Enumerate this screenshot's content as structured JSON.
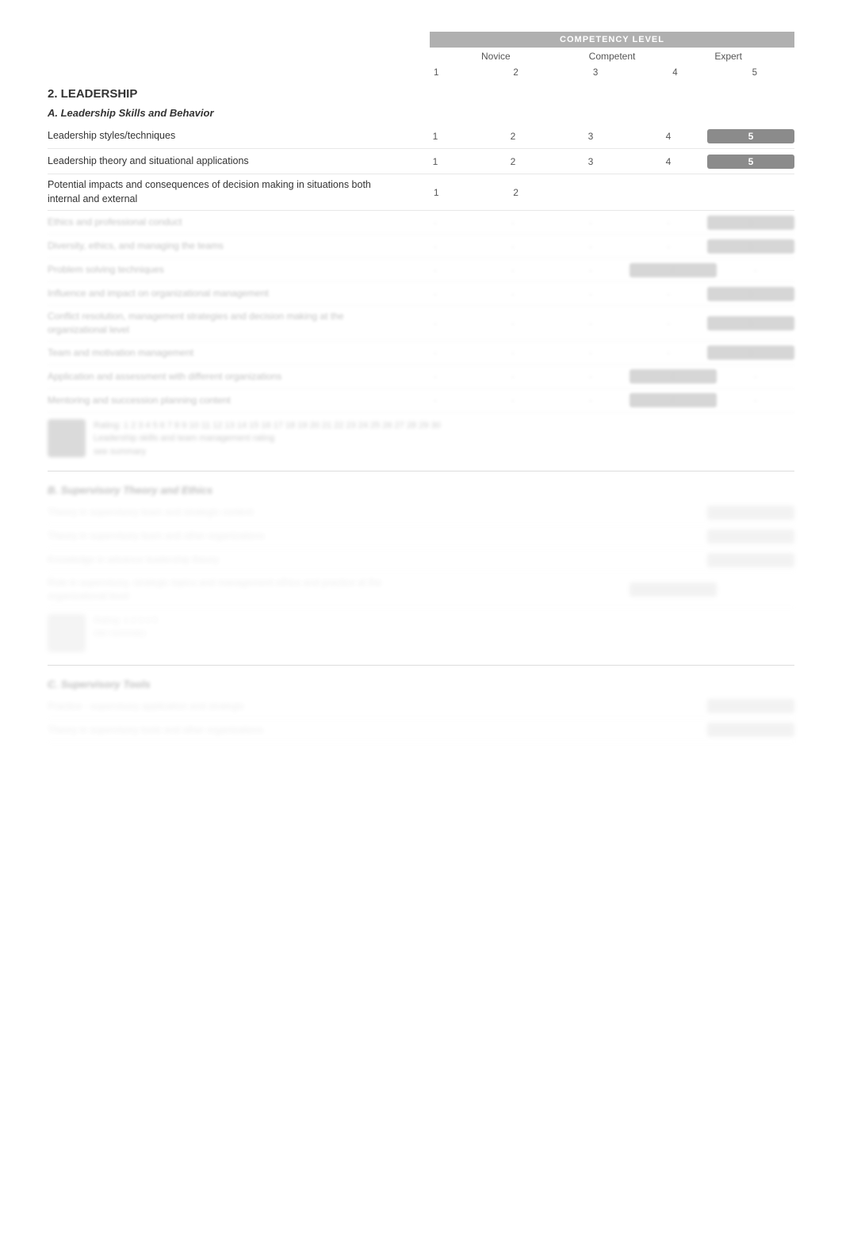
{
  "header": {
    "competency_level_label": "COMPETENCY LEVEL",
    "novice": "Novice",
    "competent": "Competent",
    "expert": "Expert",
    "col1": "1",
    "col2": "2",
    "col3": "3",
    "col4": "4",
    "col5": "5"
  },
  "section2": {
    "title": "2.   LEADERSHIP"
  },
  "sectionA": {
    "title": "A.  Leadership Skills and Behavior",
    "rows": [
      {
        "label": "Leadership styles/techniques",
        "values": [
          "1",
          "2",
          "3",
          "4",
          "5"
        ],
        "highlighted": 4
      },
      {
        "label": "Leadership theory and situational applications",
        "values": [
          "1",
          "2",
          "3",
          "4",
          "5"
        ],
        "highlighted": 4
      },
      {
        "label": "Potential impacts and consequences of decision making in situations both internal and external",
        "values": [
          "1",
          "2",
          "",
          "",
          ""
        ],
        "highlighted": -1
      }
    ],
    "blurred_rows": [
      {
        "label": "Ethics and professional conduct",
        "values": [
          "",
          "",
          "",
          "",
          ""
        ]
      },
      {
        "label": "Diversity, ethics, and managing the teams",
        "values": [
          "",
          "",
          "",
          "",
          ""
        ]
      },
      {
        "label": "Problem solving techniques",
        "values": [
          "",
          "",
          "",
          "",
          ""
        ]
      },
      {
        "label": "Influence and impact on organizational management",
        "values": [
          "",
          "",
          "",
          "",
          ""
        ]
      },
      {
        "label": "Conflict resolution, management strategies and decision making at the organizational level",
        "values": [
          "",
          "",
          "",
          "",
          ""
        ]
      },
      {
        "label": "Team and motivation management",
        "values": [
          "",
          "",
          "",
          "",
          ""
        ]
      },
      {
        "label": "Application and assessment with different organizations",
        "values": [
          "",
          "",
          "",
          "",
          ""
        ]
      },
      {
        "label": "Mentoring and succession planning content",
        "values": [
          "",
          "",
          "",
          "",
          ""
        ]
      }
    ]
  },
  "sectionB": {
    "title": "B.  Supervisory Theory and Ethics",
    "blurred_rows": [
      {
        "label": "Theory in supervisory team and strategic content",
        "values": [
          "",
          "",
          "",
          "",
          ""
        ]
      },
      {
        "label": "Theory in supervisory team and other organizations",
        "values": [
          "",
          "",
          "",
          "",
          ""
        ]
      },
      {
        "label": "Knowledge in advance leadership theory",
        "values": [
          "",
          "",
          "",
          "",
          ""
        ]
      },
      {
        "label": "Role in supervisory, strategic topics and management ethics and practice at the organizational level",
        "values": [
          "",
          "",
          "",
          "",
          ""
        ]
      }
    ]
  },
  "sectionC": {
    "title": "C.  Supervisory Tools",
    "blurred_rows": [
      {
        "label": "Practice - supervisory application and strategic",
        "values": [
          "",
          "",
          "",
          "",
          ""
        ]
      },
      {
        "label": "Theory in supervisory tools and other organizations",
        "values": [
          "",
          "",
          "",
          "",
          ""
        ]
      }
    ]
  }
}
